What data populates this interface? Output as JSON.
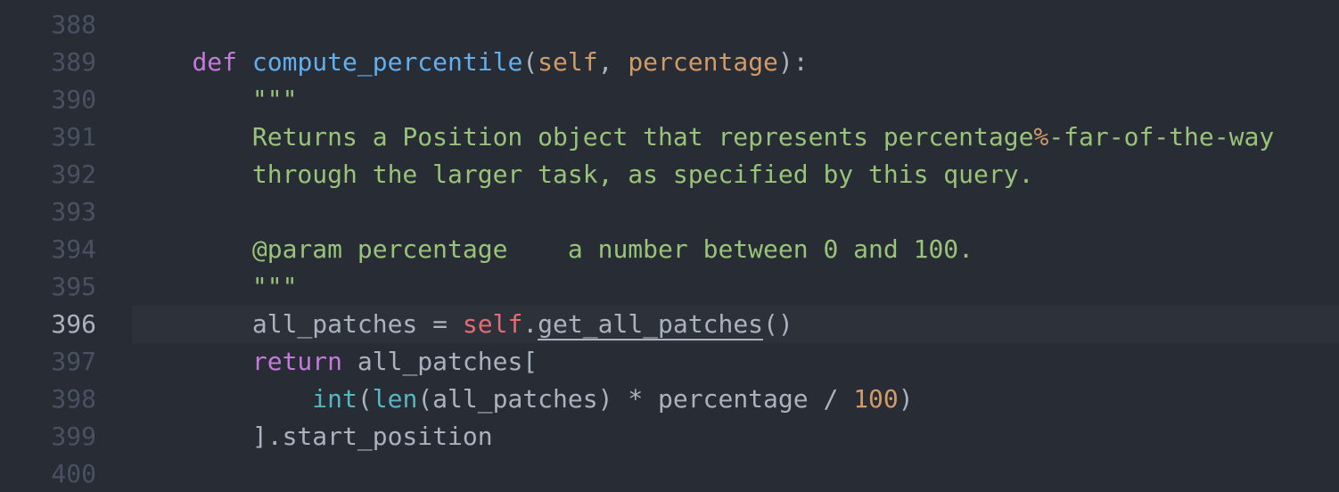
{
  "editor": {
    "active_line": "396",
    "lines": [
      {
        "no": "388",
        "tokens": []
      },
      {
        "no": "389",
        "tokens": [
          {
            "t": "    ",
            "c": "punc"
          },
          {
            "t": "def",
            "c": "kw"
          },
          {
            "t": " ",
            "c": "punc"
          },
          {
            "t": "compute_percentile",
            "c": "fn"
          },
          {
            "t": "(",
            "c": "punc"
          },
          {
            "t": "self",
            "c": "param"
          },
          {
            "t": ", ",
            "c": "punc"
          },
          {
            "t": "percentage",
            "c": "param"
          },
          {
            "t": "):",
            "c": "punc"
          }
        ]
      },
      {
        "no": "390",
        "tokens": [
          {
            "t": "        ",
            "c": "punc"
          },
          {
            "t": "\"\"\"",
            "c": "str"
          }
        ]
      },
      {
        "no": "391",
        "tokens": [
          {
            "t": "        ",
            "c": "punc"
          },
          {
            "t": "Returns a Position object that represents percentage",
            "c": "str"
          },
          {
            "t": "%",
            "c": "fmt"
          },
          {
            "t": "-far-of-the-way",
            "c": "str"
          }
        ]
      },
      {
        "no": "392",
        "tokens": [
          {
            "t": "        ",
            "c": "punc"
          },
          {
            "t": "through the larger task, as specified by this query.",
            "c": "str"
          }
        ]
      },
      {
        "no": "393",
        "tokens": []
      },
      {
        "no": "394",
        "tokens": [
          {
            "t": "        ",
            "c": "punc"
          },
          {
            "t": "@param percentage    a number between 0 and 100.",
            "c": "str"
          }
        ]
      },
      {
        "no": "395",
        "tokens": [
          {
            "t": "        ",
            "c": "punc"
          },
          {
            "t": "\"\"\"",
            "c": "str"
          }
        ]
      },
      {
        "no": "396",
        "tokens": [
          {
            "t": "        ",
            "c": "punc"
          },
          {
            "t": "all_patches = ",
            "c": "punc"
          },
          {
            "t": "self",
            "c": "self"
          },
          {
            "t": ".",
            "c": "punc"
          },
          {
            "t": "get_all_patches",
            "c": "under"
          },
          {
            "t": "()",
            "c": "punc"
          }
        ]
      },
      {
        "no": "397",
        "tokens": [
          {
            "t": "        ",
            "c": "punc"
          },
          {
            "t": "return",
            "c": "kw"
          },
          {
            "t": " all_patches[",
            "c": "punc"
          }
        ]
      },
      {
        "no": "398",
        "tokens": [
          {
            "t": "            ",
            "c": "punc"
          },
          {
            "t": "int",
            "c": "builtin"
          },
          {
            "t": "(",
            "c": "punc"
          },
          {
            "t": "len",
            "c": "builtin"
          },
          {
            "t": "(all_patches) * percentage / ",
            "c": "punc"
          },
          {
            "t": "100",
            "c": "num"
          },
          {
            "t": ")",
            "c": "punc"
          }
        ]
      },
      {
        "no": "399",
        "tokens": [
          {
            "t": "        ",
            "c": "punc"
          },
          {
            "t": "].start_position",
            "c": "punc"
          }
        ]
      },
      {
        "no": "400",
        "tokens": []
      }
    ]
  }
}
